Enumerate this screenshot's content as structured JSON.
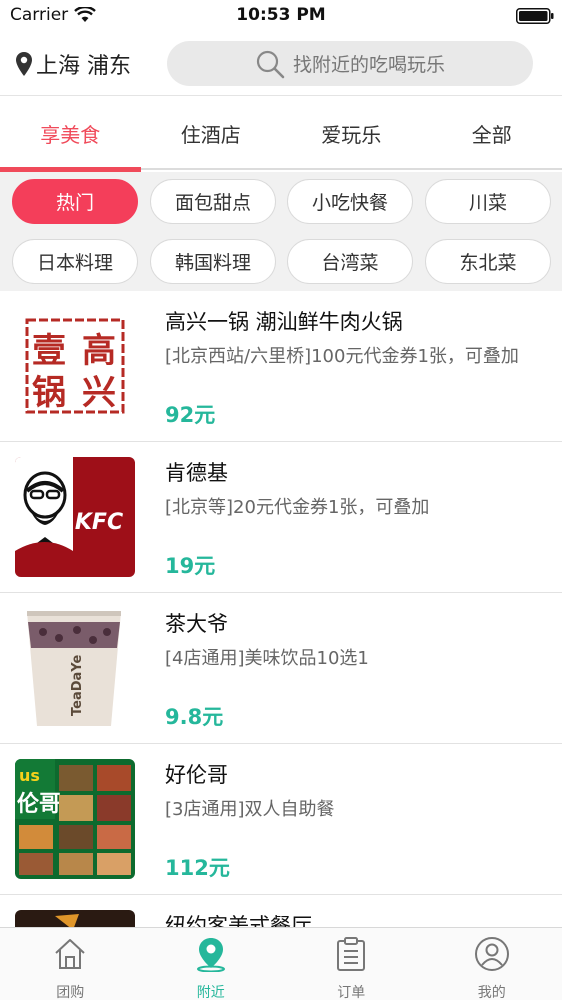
{
  "status_bar": {
    "carrier": "Carrier",
    "time": "10:53 PM"
  },
  "header": {
    "location": "上海 浦东",
    "search_placeholder": "找附近的吃喝玩乐"
  },
  "tabs": [
    {
      "label": "享美食",
      "active": true
    },
    {
      "label": "住酒店",
      "active": false
    },
    {
      "label": "爱玩乐",
      "active": false
    },
    {
      "label": "全部",
      "active": false
    }
  ],
  "pills": [
    {
      "label": "热门",
      "active": true
    },
    {
      "label": "面包甜点",
      "active": false
    },
    {
      "label": "小吃快餐",
      "active": false
    },
    {
      "label": "川菜",
      "active": false
    },
    {
      "label": "日本料理",
      "active": false
    },
    {
      "label": "韩国料理",
      "active": false
    },
    {
      "label": "台湾菜",
      "active": false
    },
    {
      "label": "东北菜",
      "active": false
    }
  ],
  "listings": [
    {
      "title": "高兴一锅 潮汕鲜牛肉火锅",
      "desc": "[北京西站/六里桥]100元代金券1张，可叠加",
      "price": "92元",
      "thumb_icon": "gaoxing-yiguo-seal-logo",
      "thumb_text": "壹高锅兴"
    },
    {
      "title": "肯德基",
      "desc": "[北京等]20元代金券1张，可叠加",
      "price": "19元",
      "thumb_icon": "kfc-logo",
      "thumb_text": "KFC"
    },
    {
      "title": "茶大爷",
      "desc": "[4店通用]美味饮品10选1",
      "price": "9.8元",
      "thumb_icon": "bubble-tea-cup-photo",
      "thumb_text": "TeaDaYe"
    },
    {
      "title": "好伦哥",
      "desc": "[3店通用]双人自助餐",
      "price": "112元",
      "thumb_icon": "buffet-food-photo",
      "thumb_text": "伦哥"
    },
    {
      "title": "纽约客美式餐厅",
      "desc": "",
      "price": "",
      "thumb_icon": "food-photo",
      "thumb_text": ""
    }
  ],
  "tabbar": [
    {
      "label": "团购",
      "icon": "house-icon",
      "active": false
    },
    {
      "label": "附近",
      "icon": "location-pin-icon",
      "active": true
    },
    {
      "label": "订单",
      "icon": "clipboard-icon",
      "active": false
    },
    {
      "label": "我的",
      "icon": "user-icon",
      "active": false
    }
  ],
  "colors": {
    "accent_red": "#f04a5a",
    "accent_green": "#25b79b"
  }
}
